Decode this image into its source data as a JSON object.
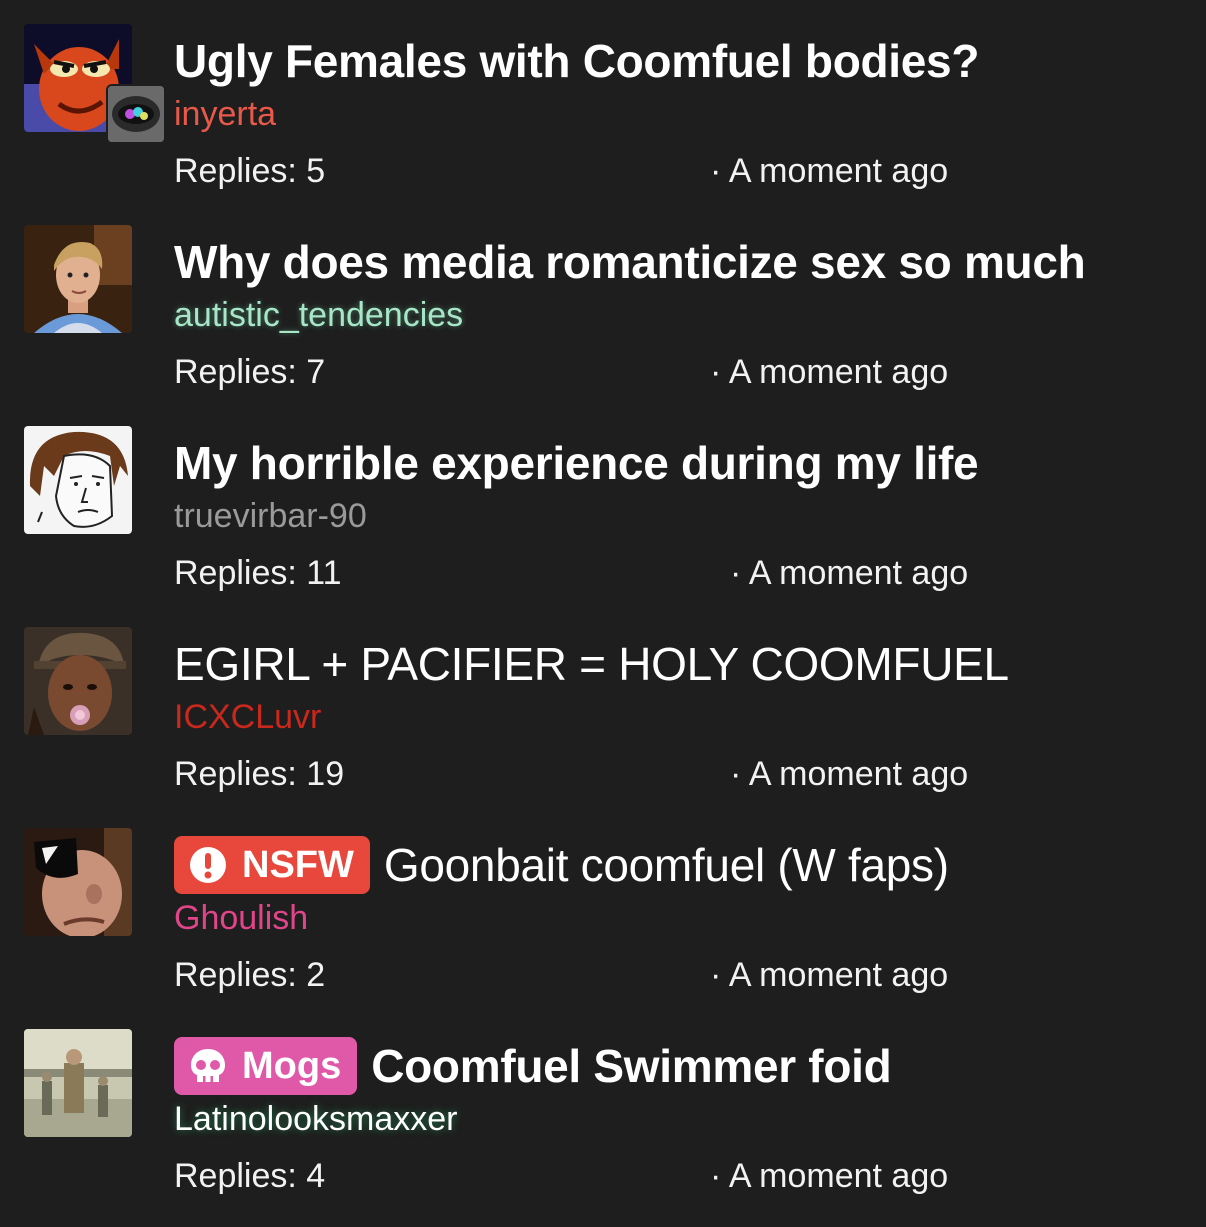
{
  "threads": [
    {
      "title": "Ugly Females with Coomfuel bodies?",
      "username": "inyerta",
      "username_color": "#e8594a",
      "replies": "Replies: 5",
      "time": "· A moment ago",
      "avatar_icon": "crash-bandicoot-avatar",
      "mini_avatar_icon": "gem-mouth-avatar"
    },
    {
      "title": "Why does media romanticize sex so much",
      "username": "autistic_tendencies",
      "username_color": "#a8e6c8",
      "replies": "Replies: 7",
      "time": "· A moment ago",
      "avatar_icon": "young-man-photo-avatar"
    },
    {
      "title": "My horrible experience during my life",
      "username": "truevirbar-90",
      "username_color": "#9a9a9a",
      "replies": "Replies: 11",
      "time": "· A moment ago",
      "avatar_icon": "wojak-drawing-avatar"
    },
    {
      "title": "EGIRL + PACIFIER = HOLY COOMFUEL",
      "username": "ICXCLuvr",
      "username_color": "#c9281c",
      "replies": "Replies: 19",
      "time": "· A moment ago",
      "avatar_icon": "game-character-pacifier-avatar"
    },
    {
      "tag": {
        "label": "NSFW",
        "color": "#e8483c",
        "icon": "exclamation-circle-icon"
      },
      "title": "Goonbait coomfuel (W faps)",
      "username": "Ghoulish",
      "username_color": "#e0458a",
      "replies": "Replies: 2",
      "time": "· A moment ago",
      "avatar_icon": "sunglasses-face-avatar"
    },
    {
      "tag": {
        "label": "Mogs",
        "color": "#e058a8",
        "icon": "skull-icon"
      },
      "title": "Coomfuel Swimmer foid",
      "username": "Latinolooksmaxxer",
      "username_color": "#ffffff",
      "replies": "Replies: 4",
      "time": "· A moment ago",
      "avatar_icon": "soldiers-photo-avatar"
    }
  ]
}
